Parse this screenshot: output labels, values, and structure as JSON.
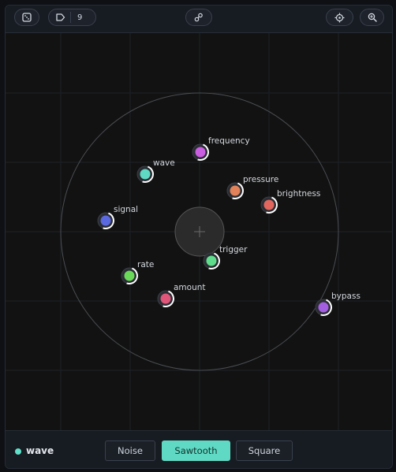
{
  "toolbar": {
    "randomize_icon": "dice-icon",
    "tag_icon": "tag-icon",
    "tag_count": "9",
    "link_icon": "nodes-link-icon",
    "target_icon": "crosshair-target-icon",
    "zoom_icon": "zoom-in-icon"
  },
  "params": [
    {
      "name": "frequency",
      "color": "#c95ee0"
    },
    {
      "name": "wave",
      "color": "#5fd9c3"
    },
    {
      "name": "pressure",
      "color": "#e2825a"
    },
    {
      "name": "brightness",
      "color": "#e0665e"
    },
    {
      "name": "signal",
      "color": "#5b69e0"
    },
    {
      "name": "trigger",
      "color": "#5fdc8c"
    },
    {
      "name": "rate",
      "color": "#6ad959"
    },
    {
      "name": "amount",
      "color": "#e0567a"
    },
    {
      "name": "bypass",
      "color": "#a45ee0"
    }
  ],
  "footer": {
    "selected_name": "wave",
    "selected_color": "#5fe0c8",
    "waveforms": [
      {
        "label": "Noise",
        "active": false
      },
      {
        "label": "Sawtooth",
        "active": true
      },
      {
        "label": "Square",
        "active": false
      }
    ]
  }
}
